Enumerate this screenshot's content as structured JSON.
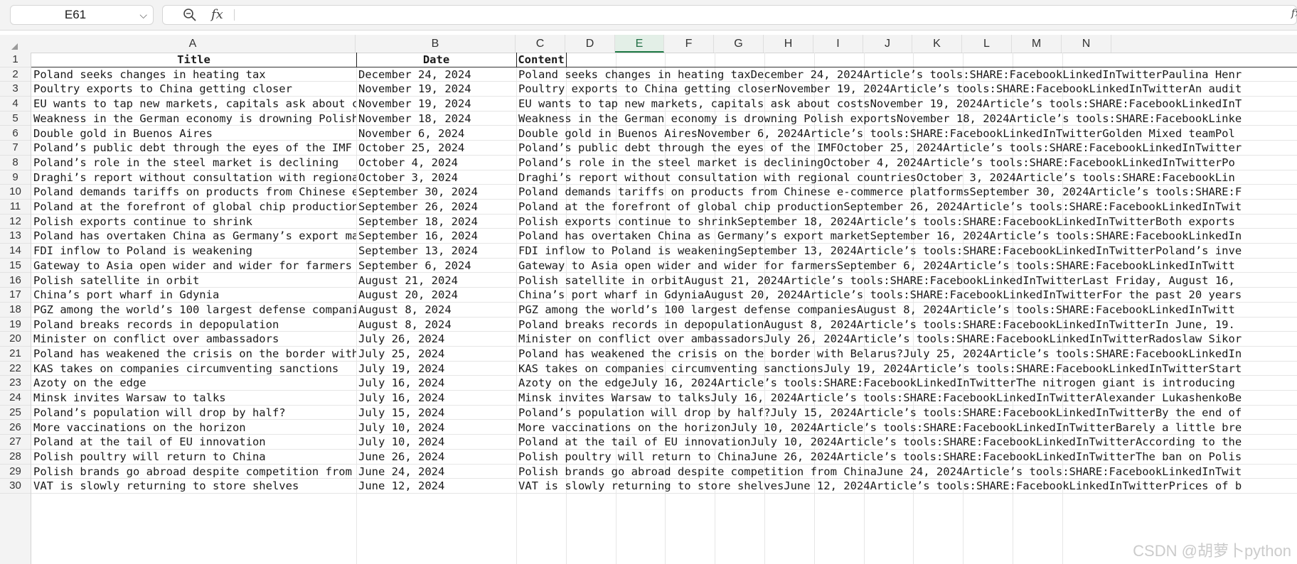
{
  "formula_bar": {
    "cell_ref": "E61",
    "fx_label": "fx",
    "formula_value": "",
    "right_icon": "fx-expand-icon"
  },
  "columns": [
    "A",
    "B",
    "C",
    "D",
    "E",
    "F",
    "G",
    "H",
    "I",
    "J",
    "K",
    "L",
    "M",
    "N"
  ],
  "active_column": "E",
  "rows": [
    1,
    2,
    3,
    4,
    5,
    6,
    7,
    8,
    9,
    10,
    11,
    12,
    13,
    14,
    15,
    16,
    17,
    18,
    19,
    20,
    21,
    22,
    23,
    24,
    25,
    26,
    27,
    28,
    29,
    30
  ],
  "table": {
    "headers": {
      "title": "Title",
      "date": "Date",
      "content": "Content"
    },
    "records": [
      {
        "title": "Poland seeks changes in heating tax",
        "date": "December 24, 2024",
        "content": "Poland seeks changes in heating taxDecember 24, 2024Article’s tools:SHARE:FacebookLinkedInTwitterPaulina Henr"
      },
      {
        "title": "Poultry exports to China getting closer",
        "date": "November 19, 2024",
        "content": "Poultry exports to China getting closerNovember 19, 2024Article’s tools:SHARE:FacebookLinkedInTwitterAn audit"
      },
      {
        "title": "EU wants to tap new markets, capitals ask about costs",
        "date": "November 19, 2024",
        "content": "EU wants to tap new markets, capitals ask about costsNovember 19, 2024Article’s tools:SHARE:FacebookLinkedInT"
      },
      {
        "title": "Weakness in the German economy is drowning Polish exports",
        "date": "November 18, 2024",
        "content": "Weakness in the German economy is drowning Polish exportsNovember 18, 2024Article’s tools:SHARE:FacebookLinke"
      },
      {
        "title": "Double gold in Buenos Aires",
        "date": "November  6, 2024",
        "content": "Double gold in Buenos AiresNovember  6, 2024Article’s tools:SHARE:FacebookLinkedInTwitterGolden Mixed teamPol"
      },
      {
        "title": "Poland’s public debt through the eyes of the IMF",
        "date": "October 25, 2024",
        "content": "Poland’s public debt through the eyes of the IMFOctober 25, 2024Article’s tools:SHARE:FacebookLinkedInTwitter"
      },
      {
        "title": "Poland’s role in the steel market is declining",
        "date": "October  4, 2024",
        "content": "Poland’s role in the steel market is decliningOctober  4, 2024Article’s tools:SHARE:FacebookLinkedInTwitterPo"
      },
      {
        "title": "Draghi’s report without consultation with regional countries",
        "date": "October  3, 2024",
        "content": "Draghi’s report without consultation with regional countriesOctober  3, 2024Article’s tools:SHARE:FacebookLin"
      },
      {
        "title": "Poland demands tariffs on products from Chinese e-commerce platforms",
        "date": "September 30, 2024",
        "content": "Poland demands tariffs on products from Chinese e-commerce platformsSeptember 30, 2024Article’s tools:SHARE:F"
      },
      {
        "title": "Poland at the forefront of global chip production",
        "date": "September 26, 2024",
        "content": "Poland at the forefront of global chip productionSeptember 26, 2024Article’s tools:SHARE:FacebookLinkedInTwit"
      },
      {
        "title": "Polish exports continue to shrink",
        "date": "September 18, 2024",
        "content": "Polish exports continue to shrinkSeptember 18, 2024Article’s tools:SHARE:FacebookLinkedInTwitterBoth exports"
      },
      {
        "title": "Poland has overtaken China as Germany’s export market",
        "date": "September 16, 2024",
        "content": "Poland has overtaken China as Germany’s export marketSeptember 16, 2024Article’s tools:SHARE:FacebookLinkedIn"
      },
      {
        "title": "FDI inflow to Poland is weakening",
        "date": "September 13, 2024",
        "content": "FDI inflow to Poland is weakeningSeptember 13, 2024Article’s tools:SHARE:FacebookLinkedInTwitterPoland’s inve"
      },
      {
        "title": "Gateway to Asia open wider and wider for farmers",
        "date": "September  6, 2024",
        "content": "Gateway to Asia open wider and wider for farmersSeptember  6, 2024Article’s tools:SHARE:FacebookLinkedInTwitt"
      },
      {
        "title": "Polish satellite in orbit",
        "date": "August 21, 2024",
        "content": "Polish satellite in orbitAugust 21, 2024Article’s tools:SHARE:FacebookLinkedInTwitterLast Friday, August 16,"
      },
      {
        "title": "China’s port wharf in Gdynia",
        "date": "August 20, 2024",
        "content": "China’s port wharf in GdyniaAugust 20, 2024Article’s tools:SHARE:FacebookLinkedInTwitterFor the past 20 years"
      },
      {
        "title": "PGZ among the world’s 100 largest defense companies",
        "date": "August  8, 2024",
        "content": "PGZ among the world’s 100 largest defense companiesAugust  8, 2024Article’s tools:SHARE:FacebookLinkedInTwitt"
      },
      {
        "title": "Poland breaks records in depopulation",
        "date": "August  8, 2024",
        "content": "Poland breaks records in depopulationAugust  8, 2024Article’s tools:SHARE:FacebookLinkedInTwitterIn June, 19."
      },
      {
        "title": "Minister on conflict over ambassadors",
        "date": "July 26, 2024",
        "content": "Minister on conflict over ambassadorsJuly 26, 2024Article’s tools:SHARE:FacebookLinkedInTwitterRadoslaw Sikor"
      },
      {
        "title": "Poland has weakened the crisis on the border with Belarus?",
        "date": "July 25, 2024",
        "content": "Poland has weakened the crisis on the border with Belarus?July 25, 2024Article’s tools:SHARE:FacebookLinkedIn"
      },
      {
        "title": "KAS takes on companies circumventing sanctions",
        "date": "July 19, 2024",
        "content": "KAS takes on companies circumventing sanctionsJuly 19, 2024Article’s tools:SHARE:FacebookLinkedInTwitterStart"
      },
      {
        "title": "Azoty on the edge",
        "date": "July 16, 2024",
        "content": "Azoty on the edgeJuly 16, 2024Article’s tools:SHARE:FacebookLinkedInTwitterThe nitrogen giant is introducing"
      },
      {
        "title": "Minsk invites Warsaw to talks",
        "date": "July 16, 2024",
        "content": "Minsk invites Warsaw to talksJuly 16, 2024Article’s tools:SHARE:FacebookLinkedInTwitterAlexander LukashenkoBe"
      },
      {
        "title": "Poland’s population will drop by half?",
        "date": "July 15, 2024",
        "content": "Poland’s population will drop by half?July 15, 2024Article’s tools:SHARE:FacebookLinkedInTwitterBy the end of"
      },
      {
        "title": "More vaccinations on the horizon",
        "date": "July 10, 2024",
        "content": "More vaccinations on the horizonJuly 10, 2024Article’s tools:SHARE:FacebookLinkedInTwitterBarely a little bre"
      },
      {
        "title": "Poland at the tail of EU innovation",
        "date": "July 10, 2024",
        "content": "Poland at the tail of EU innovationJuly 10, 2024Article’s tools:SHARE:FacebookLinkedInTwitterAccording to the"
      },
      {
        "title": "Polish poultry will return to China",
        "date": "June 26, 2024",
        "content": "Polish poultry will return to ChinaJune 26, 2024Article’s tools:SHARE:FacebookLinkedInTwitterThe ban on Polis"
      },
      {
        "title": "Polish brands go abroad despite competition from China",
        "date": "June 24, 2024",
        "content": "Polish brands go abroad despite competition from ChinaJune 24, 2024Article’s tools:SHARE:FacebookLinkedInTwit"
      },
      {
        "title": "VAT is slowly returning to store shelves",
        "date": "June 12, 2024",
        "content": "VAT is slowly returning to store shelvesJune 12, 2024Article’s tools:SHARE:FacebookLinkedInTwitterPrices of b"
      }
    ]
  },
  "watermark": "CSDN @胡萝卜python"
}
